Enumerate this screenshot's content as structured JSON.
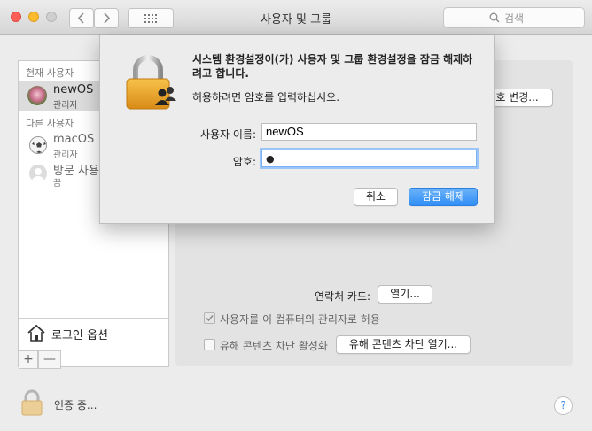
{
  "window": {
    "title": "사용자 및 그룹",
    "search_placeholder": "검색"
  },
  "sidebar": {
    "current_users_header": "현재 사용자",
    "current_user": {
      "name": "newOS",
      "role": "관리자"
    },
    "other_users_header": "다른 사용자",
    "other_users": [
      {
        "name": "macOS",
        "role": "관리자"
      },
      {
        "name": "방문 사용자",
        "role": "끔"
      }
    ],
    "login_options_label": "로그인 옵션",
    "add_label": "+",
    "remove_label": "—"
  },
  "main": {
    "change_password_label": "암호 변경...",
    "contact_card_label": "연락처 카드:",
    "open_button_label": "열기...",
    "allow_admin_label": "사용자를 이 컴퓨터의 관리자로 허용",
    "allow_admin_checked": true,
    "parental_controls_label": "유해 콘텐츠 차단 활성화",
    "parental_controls_checked": false,
    "open_parental_controls_label": "유해 콘텐츠 차단 열기..."
  },
  "dialog": {
    "title": "시스템 환경설정이(가) 사용자 및 그룹 환경설정을 잠금 해제하려고 합니다.",
    "message": "허용하려면 암호를 입력하십시오.",
    "username_label": "사용자 이름:",
    "username_value": "newOS",
    "password_label": "암호:",
    "password_value": "●",
    "cancel_label": "취소",
    "unlock_label": "잠금 해제"
  },
  "footer": {
    "status_text": "인증 중...",
    "help_label": "?"
  }
}
